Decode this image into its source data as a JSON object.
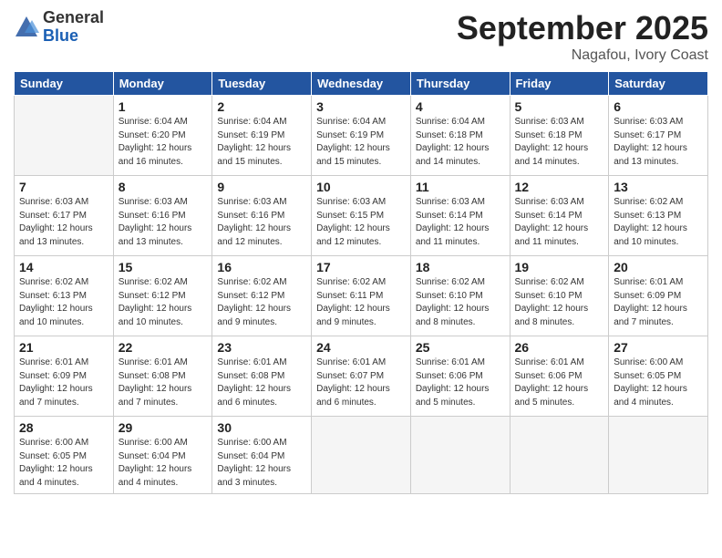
{
  "logo": {
    "general": "General",
    "blue": "Blue"
  },
  "title": "September 2025",
  "subtitle": "Nagafou, Ivory Coast",
  "days_of_week": [
    "Sunday",
    "Monday",
    "Tuesday",
    "Wednesday",
    "Thursday",
    "Friday",
    "Saturday"
  ],
  "weeks": [
    [
      {
        "num": "",
        "info": ""
      },
      {
        "num": "1",
        "info": "Sunrise: 6:04 AM\nSunset: 6:20 PM\nDaylight: 12 hours\nand 16 minutes."
      },
      {
        "num": "2",
        "info": "Sunrise: 6:04 AM\nSunset: 6:19 PM\nDaylight: 12 hours\nand 15 minutes."
      },
      {
        "num": "3",
        "info": "Sunrise: 6:04 AM\nSunset: 6:19 PM\nDaylight: 12 hours\nand 15 minutes."
      },
      {
        "num": "4",
        "info": "Sunrise: 6:04 AM\nSunset: 6:18 PM\nDaylight: 12 hours\nand 14 minutes."
      },
      {
        "num": "5",
        "info": "Sunrise: 6:03 AM\nSunset: 6:18 PM\nDaylight: 12 hours\nand 14 minutes."
      },
      {
        "num": "6",
        "info": "Sunrise: 6:03 AM\nSunset: 6:17 PM\nDaylight: 12 hours\nand 13 minutes."
      }
    ],
    [
      {
        "num": "7",
        "info": "Sunrise: 6:03 AM\nSunset: 6:17 PM\nDaylight: 12 hours\nand 13 minutes."
      },
      {
        "num": "8",
        "info": "Sunrise: 6:03 AM\nSunset: 6:16 PM\nDaylight: 12 hours\nand 13 minutes."
      },
      {
        "num": "9",
        "info": "Sunrise: 6:03 AM\nSunset: 6:16 PM\nDaylight: 12 hours\nand 12 minutes."
      },
      {
        "num": "10",
        "info": "Sunrise: 6:03 AM\nSunset: 6:15 PM\nDaylight: 12 hours\nand 12 minutes."
      },
      {
        "num": "11",
        "info": "Sunrise: 6:03 AM\nSunset: 6:14 PM\nDaylight: 12 hours\nand 11 minutes."
      },
      {
        "num": "12",
        "info": "Sunrise: 6:03 AM\nSunset: 6:14 PM\nDaylight: 12 hours\nand 11 minutes."
      },
      {
        "num": "13",
        "info": "Sunrise: 6:02 AM\nSunset: 6:13 PM\nDaylight: 12 hours\nand 10 minutes."
      }
    ],
    [
      {
        "num": "14",
        "info": "Sunrise: 6:02 AM\nSunset: 6:13 PM\nDaylight: 12 hours\nand 10 minutes."
      },
      {
        "num": "15",
        "info": "Sunrise: 6:02 AM\nSunset: 6:12 PM\nDaylight: 12 hours\nand 10 minutes."
      },
      {
        "num": "16",
        "info": "Sunrise: 6:02 AM\nSunset: 6:12 PM\nDaylight: 12 hours\nand 9 minutes."
      },
      {
        "num": "17",
        "info": "Sunrise: 6:02 AM\nSunset: 6:11 PM\nDaylight: 12 hours\nand 9 minutes."
      },
      {
        "num": "18",
        "info": "Sunrise: 6:02 AM\nSunset: 6:10 PM\nDaylight: 12 hours\nand 8 minutes."
      },
      {
        "num": "19",
        "info": "Sunrise: 6:02 AM\nSunset: 6:10 PM\nDaylight: 12 hours\nand 8 minutes."
      },
      {
        "num": "20",
        "info": "Sunrise: 6:01 AM\nSunset: 6:09 PM\nDaylight: 12 hours\nand 7 minutes."
      }
    ],
    [
      {
        "num": "21",
        "info": "Sunrise: 6:01 AM\nSunset: 6:09 PM\nDaylight: 12 hours\nand 7 minutes."
      },
      {
        "num": "22",
        "info": "Sunrise: 6:01 AM\nSunset: 6:08 PM\nDaylight: 12 hours\nand 7 minutes."
      },
      {
        "num": "23",
        "info": "Sunrise: 6:01 AM\nSunset: 6:08 PM\nDaylight: 12 hours\nand 6 minutes."
      },
      {
        "num": "24",
        "info": "Sunrise: 6:01 AM\nSunset: 6:07 PM\nDaylight: 12 hours\nand 6 minutes."
      },
      {
        "num": "25",
        "info": "Sunrise: 6:01 AM\nSunset: 6:06 PM\nDaylight: 12 hours\nand 5 minutes."
      },
      {
        "num": "26",
        "info": "Sunrise: 6:01 AM\nSunset: 6:06 PM\nDaylight: 12 hours\nand 5 minutes."
      },
      {
        "num": "27",
        "info": "Sunrise: 6:00 AM\nSunset: 6:05 PM\nDaylight: 12 hours\nand 4 minutes."
      }
    ],
    [
      {
        "num": "28",
        "info": "Sunrise: 6:00 AM\nSunset: 6:05 PM\nDaylight: 12 hours\nand 4 minutes."
      },
      {
        "num": "29",
        "info": "Sunrise: 6:00 AM\nSunset: 6:04 PM\nDaylight: 12 hours\nand 4 minutes."
      },
      {
        "num": "30",
        "info": "Sunrise: 6:00 AM\nSunset: 6:04 PM\nDaylight: 12 hours\nand 3 minutes."
      },
      {
        "num": "",
        "info": ""
      },
      {
        "num": "",
        "info": ""
      },
      {
        "num": "",
        "info": ""
      },
      {
        "num": "",
        "info": ""
      }
    ]
  ]
}
